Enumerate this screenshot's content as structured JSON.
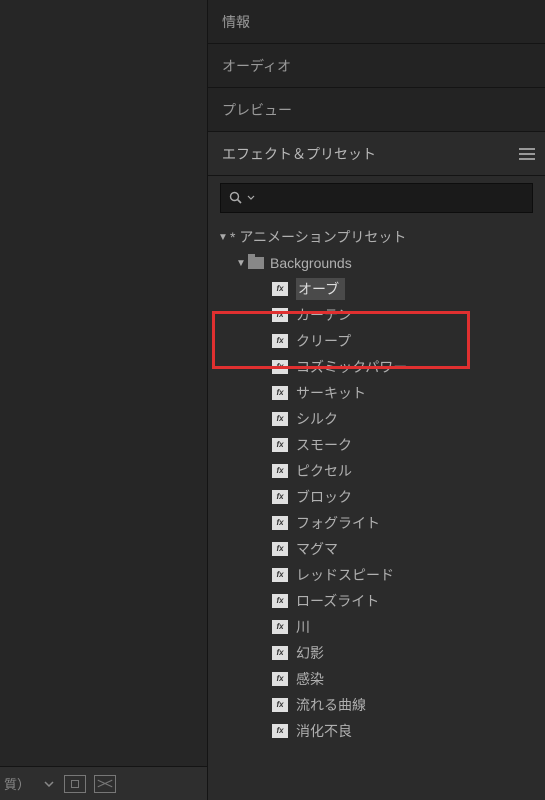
{
  "tabs": {
    "info": "情報",
    "audio": "オーディオ",
    "preview": "プレビュー",
    "effects": "エフェクト＆プリセット"
  },
  "search": {
    "placeholder": ""
  },
  "tree": {
    "root": {
      "label": "* アニメーションプリセット",
      "expanded": true
    },
    "folder": {
      "label": "Backgrounds",
      "expanded": true
    },
    "items": [
      {
        "label": "オーブ",
        "selected": true
      },
      {
        "label": "カーテン",
        "selected": false
      },
      {
        "label": "クリープ",
        "selected": false
      },
      {
        "label": "コズミックパワー",
        "selected": false
      },
      {
        "label": "サーキット",
        "selected": false
      },
      {
        "label": "シルク",
        "selected": false
      },
      {
        "label": "スモーク",
        "selected": false
      },
      {
        "label": "ピクセル",
        "selected": false
      },
      {
        "label": "ブロック",
        "selected": false
      },
      {
        "label": "フォグライト",
        "selected": false
      },
      {
        "label": "マグマ",
        "selected": false
      },
      {
        "label": "レッドスピード",
        "selected": false
      },
      {
        "label": "ローズライト",
        "selected": false
      },
      {
        "label": "川",
        "selected": false
      },
      {
        "label": "幻影",
        "selected": false
      },
      {
        "label": "感染",
        "selected": false
      },
      {
        "label": "流れる曲線",
        "selected": false
      },
      {
        "label": "消化不良",
        "selected": false
      }
    ]
  },
  "bottomBar": {
    "fragment": "質）"
  }
}
